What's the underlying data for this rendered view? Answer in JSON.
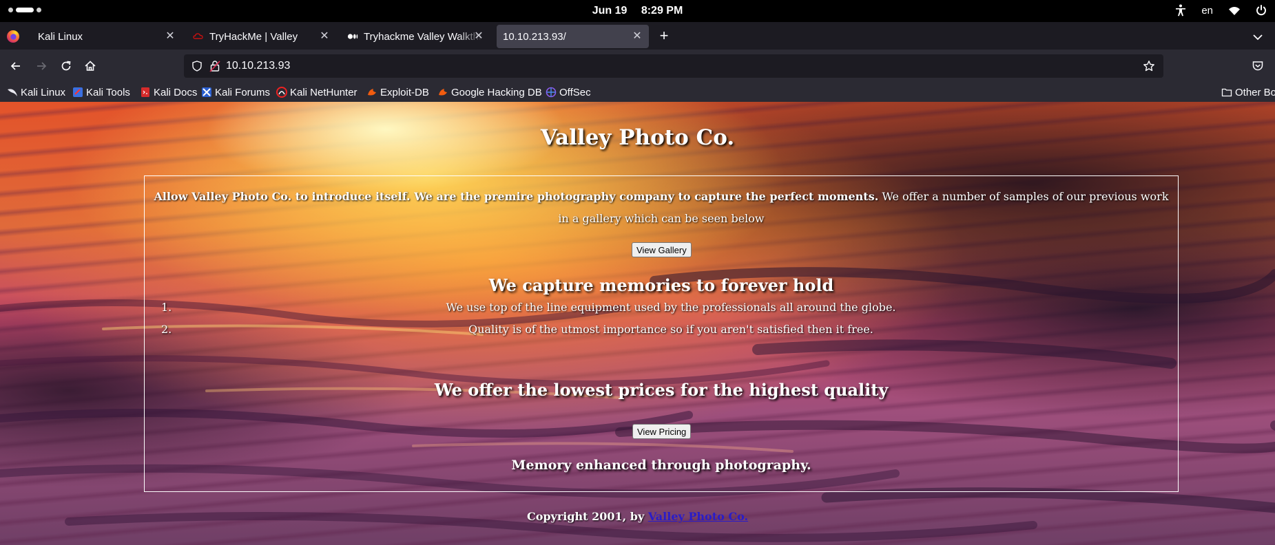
{
  "system": {
    "date": "Jun 19",
    "time": "8:29 PM",
    "language": "en"
  },
  "tabs": [
    {
      "title": "Kali Linux",
      "active": false
    },
    {
      "title": "TryHackMe | Valley",
      "active": false
    },
    {
      "title": "Tryhackme Valley Walkthrough",
      "active": false
    },
    {
      "title": "10.10.213.93/",
      "active": true
    }
  ],
  "navbar": {
    "url": "10.10.213.93"
  },
  "bookmarks": [
    {
      "label": "Kali Linux",
      "icon": "kali-dragon-icon"
    },
    {
      "label": "Kali Tools",
      "icon": "kali-tools-icon"
    },
    {
      "label": "Kali Docs",
      "icon": "kali-docs-icon"
    },
    {
      "label": "Kali Forums",
      "icon": "kali-forums-icon"
    },
    {
      "label": "Kali NetHunter",
      "icon": "nethunter-icon"
    },
    {
      "label": "Exploit-DB",
      "icon": "exploit-db-icon"
    },
    {
      "label": "Google Hacking DB",
      "icon": "ghdb-icon"
    },
    {
      "label": "OffSec",
      "icon": "offsec-icon"
    }
  ],
  "other_bookmarks": "Other Bo",
  "page": {
    "title": "Valley Photo Co.",
    "intro_bold": "Allow Valley Photo Co. to introduce itself. We are the premire photography company to capture the perfect moments.",
    "intro_rest": " We offer a number of samples of our previous work in a gallery which can be seen below",
    "gallery_button": "View Gallery",
    "heading_memories": "We capture memories to forever hold",
    "list": [
      {
        "num": "1.",
        "text": "We use top of the line equipment used by the professionals all around the globe."
      },
      {
        "num": "2.",
        "text": "Quality is of the utmost importance so if you aren't satisfied then it free."
      }
    ],
    "heading_prices": "We offer the lowest prices for the highest quality",
    "pricing_button": "View Pricing",
    "tagline": "Memory enhanced through photography.",
    "footer_prefix": "Copyright 2001, by ",
    "footer_link": "Valley Photo Co."
  }
}
